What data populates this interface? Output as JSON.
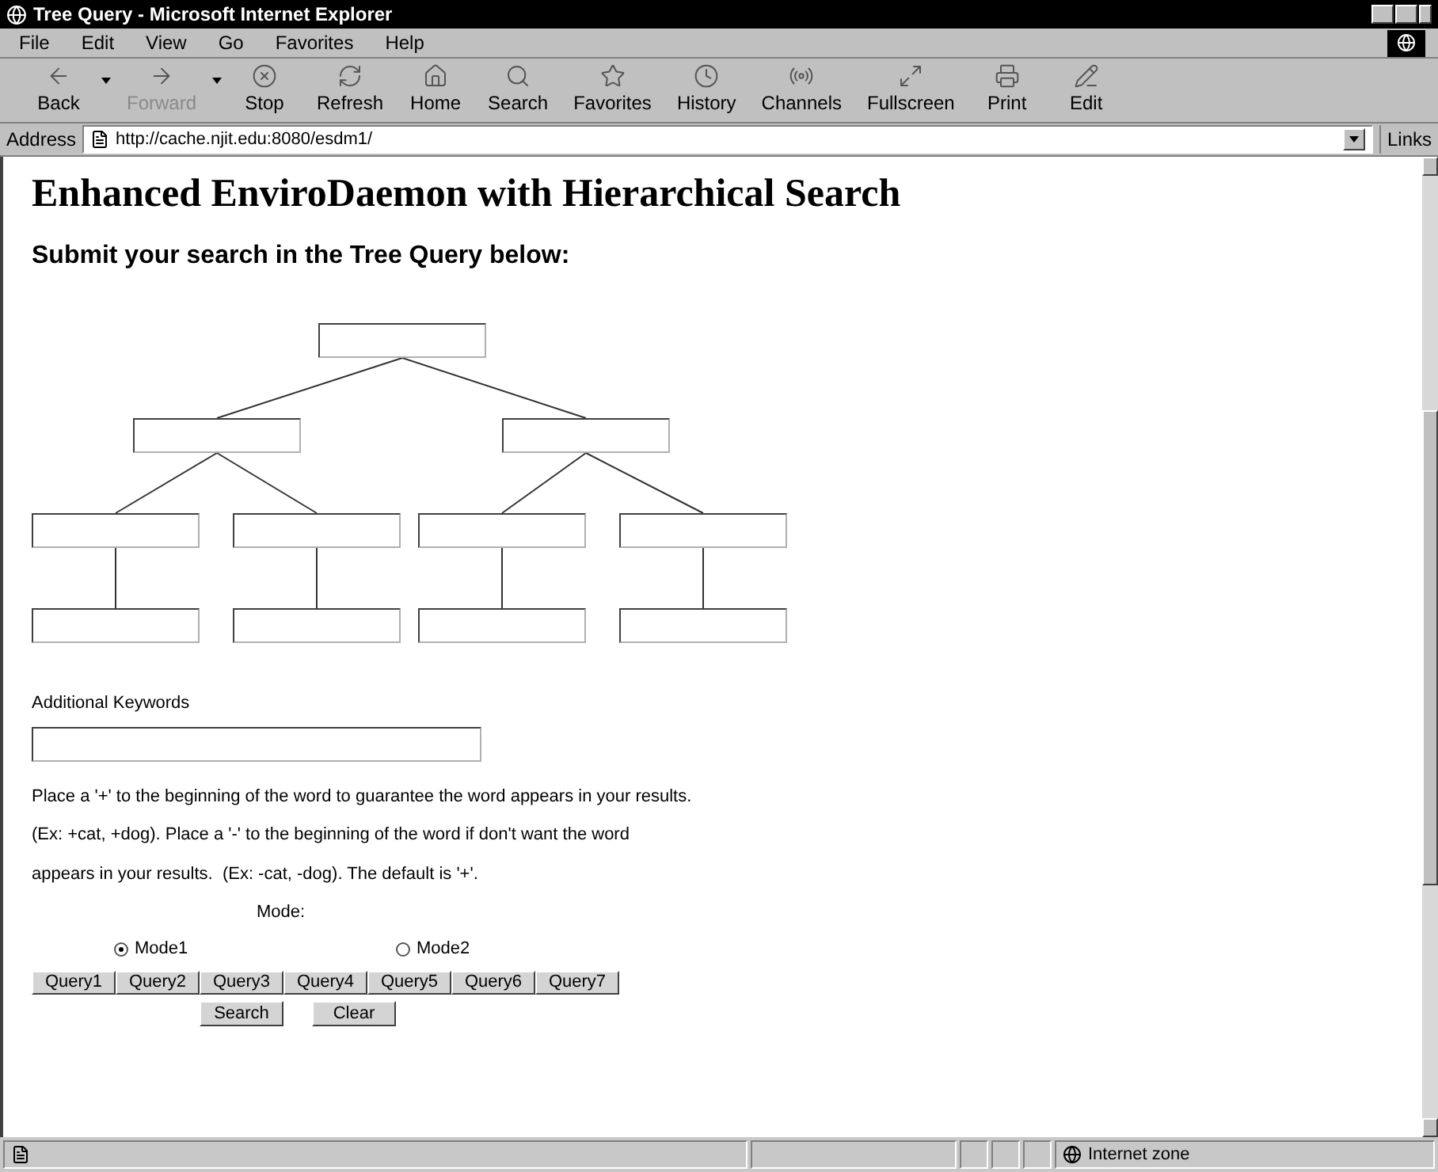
{
  "window": {
    "title": "Tree Query - Microsoft Internet Explorer"
  },
  "menu": [
    "File",
    "Edit",
    "View",
    "Go",
    "Favorites",
    "Help"
  ],
  "toolbar": [
    {
      "label": "Back",
      "kind": "back",
      "disabled": false,
      "dropdown": true
    },
    {
      "label": "Forward",
      "kind": "forward",
      "disabled": true,
      "dropdown": true
    },
    {
      "label": "Stop",
      "kind": "stop",
      "disabled": false,
      "dropdown": false
    },
    {
      "label": "Refresh",
      "kind": "refresh",
      "disabled": false,
      "dropdown": false
    },
    {
      "label": "Home",
      "kind": "home",
      "disabled": false,
      "dropdown": false
    },
    {
      "label": "Search",
      "kind": "search",
      "disabled": false,
      "dropdown": false
    },
    {
      "label": "Favorites",
      "kind": "favorites",
      "disabled": false,
      "dropdown": false
    },
    {
      "label": "History",
      "kind": "history",
      "disabled": false,
      "dropdown": false
    },
    {
      "label": "Channels",
      "kind": "channels",
      "disabled": false,
      "dropdown": false
    },
    {
      "label": "Fullscreen",
      "kind": "fullscreen",
      "disabled": false,
      "dropdown": false
    },
    {
      "label": "Print",
      "kind": "print",
      "disabled": false,
      "dropdown": false
    },
    {
      "label": "Edit",
      "kind": "edit",
      "disabled": false,
      "dropdown": false
    }
  ],
  "address": {
    "label": "Address",
    "value": "http://cache.njit.edu:8080/esdm1/",
    "links": "Links"
  },
  "page": {
    "heading": "Enhanced EnviroDaemon with Hierarchical Search",
    "subheading": "Submit your search in the Tree Query below:",
    "tree": {
      "kind": "field",
      "children": [
        {
          "kind": "field",
          "children": [
            {
              "kind": "field",
              "children": [
                {
                  "kind": "field"
                }
              ]
            },
            {
              "kind": "field",
              "children": [
                {
                  "kind": "field"
                }
              ]
            }
          ]
        },
        {
          "kind": "field",
          "children": [
            {
              "kind": "field",
              "children": [
                {
                  "kind": "field"
                }
              ]
            },
            {
              "kind": "field",
              "children": [
                {
                  "kind": "field"
                }
              ]
            }
          ]
        }
      ]
    },
    "keywords_label": "Additional Keywords",
    "help_lines": [
      "Place a '+' to the beginning of the word to guarantee the word appears in your results.",
      "(Ex: +cat, +dog). Place a '-' to the beginning of the word if don't want the word",
      "appears in your results.  (Ex: -cat, -dog). The default is '+'."
    ],
    "mode_label": "Mode:",
    "modes": [
      {
        "label": "Mode1",
        "selected": true
      },
      {
        "label": "Mode2",
        "selected": false
      }
    ],
    "query_buttons": [
      "Query1",
      "Query2",
      "Query3",
      "Query4",
      "Query5",
      "Query6",
      "Query7"
    ],
    "actions": [
      "Search",
      "Clear"
    ]
  },
  "status_bar": {
    "zone": "Internet zone"
  }
}
